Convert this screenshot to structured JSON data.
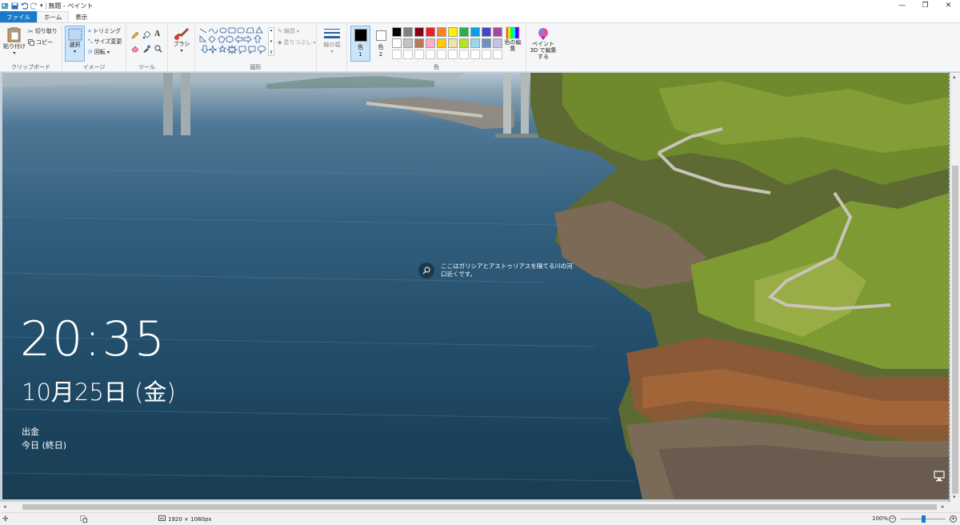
{
  "titlebar": {
    "title": "無題 - ペイント",
    "minimize": "—",
    "restore": "❐",
    "close": "✕"
  },
  "tabs": [
    "ファイル",
    "ホーム",
    "表示"
  ],
  "clipboard": {
    "paste": "貼り付け",
    "cut": "切り取り",
    "copy": "コピー",
    "label": "クリップボード"
  },
  "image": {
    "select": "選択",
    "crop": "トリミング",
    "resize": "サイズ変更",
    "rotate": "回転",
    "label": "イメージ"
  },
  "tools": {
    "label": "ツール"
  },
  "brush": {
    "label": "ブラシ"
  },
  "shapes": {
    "outline": "輪郭",
    "fill": "塗りつぶし",
    "label": "図形"
  },
  "size": {
    "label": "線の幅"
  },
  "colors": {
    "color1": "色",
    "color1_num": "1",
    "color2": "色",
    "color2_num": "2",
    "edit_colors": "色の編集",
    "label": "色",
    "palette_row1": [
      "#000000",
      "#7f7f7f",
      "#880015",
      "#ed1c24",
      "#ff7f27",
      "#fff200",
      "#22b14c",
      "#00a2e8",
      "#3f48cc",
      "#a349a4"
    ],
    "palette_row2": [
      "#ffffff",
      "#c3c3c3",
      "#b97a57",
      "#ffaec9",
      "#ffc90e",
      "#efe4b0",
      "#b5e61d",
      "#99d9ea",
      "#7092be",
      "#c8bfe7"
    ]
  },
  "paint3d": {
    "label": "ペイント 3D で編集する"
  },
  "lockscreen": {
    "time": "20:35",
    "date": "10月25日 (金)",
    "event_title": "出金",
    "event_detail": "今日 (終日)",
    "info": "ここはガリシアとアストゥリアスを隔てる川の河口近くです。"
  },
  "status": {
    "dimensions": "1920 × 1080px",
    "zoom": "100%"
  }
}
